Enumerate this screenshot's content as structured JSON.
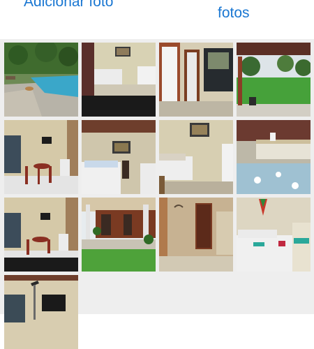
{
  "header": {
    "add_photo_label": "Adicionar foto",
    "see_photos_label": "fotos"
  },
  "colors": {
    "link": "#1a77d2",
    "gallery_background": "#eeeeee"
  },
  "photos": [
    {
      "name": "pool-photo"
    },
    {
      "name": "bedroom-twin-beds-photo"
    },
    {
      "name": "doorway-photo"
    },
    {
      "name": "garden-lawn-photo"
    },
    {
      "name": "room-table-chairs-photo"
    },
    {
      "name": "bedroom-tv-photo"
    },
    {
      "name": "bedroom-beds-photo"
    },
    {
      "name": "bedroom-blue-floor-photo"
    },
    {
      "name": "room-table-chairs-2-photo"
    },
    {
      "name": "veranda-photo"
    },
    {
      "name": "hallway-door-photo"
    },
    {
      "name": "bedroom-towels-photo"
    },
    {
      "name": "room-tv-wall-photo"
    }
  ]
}
